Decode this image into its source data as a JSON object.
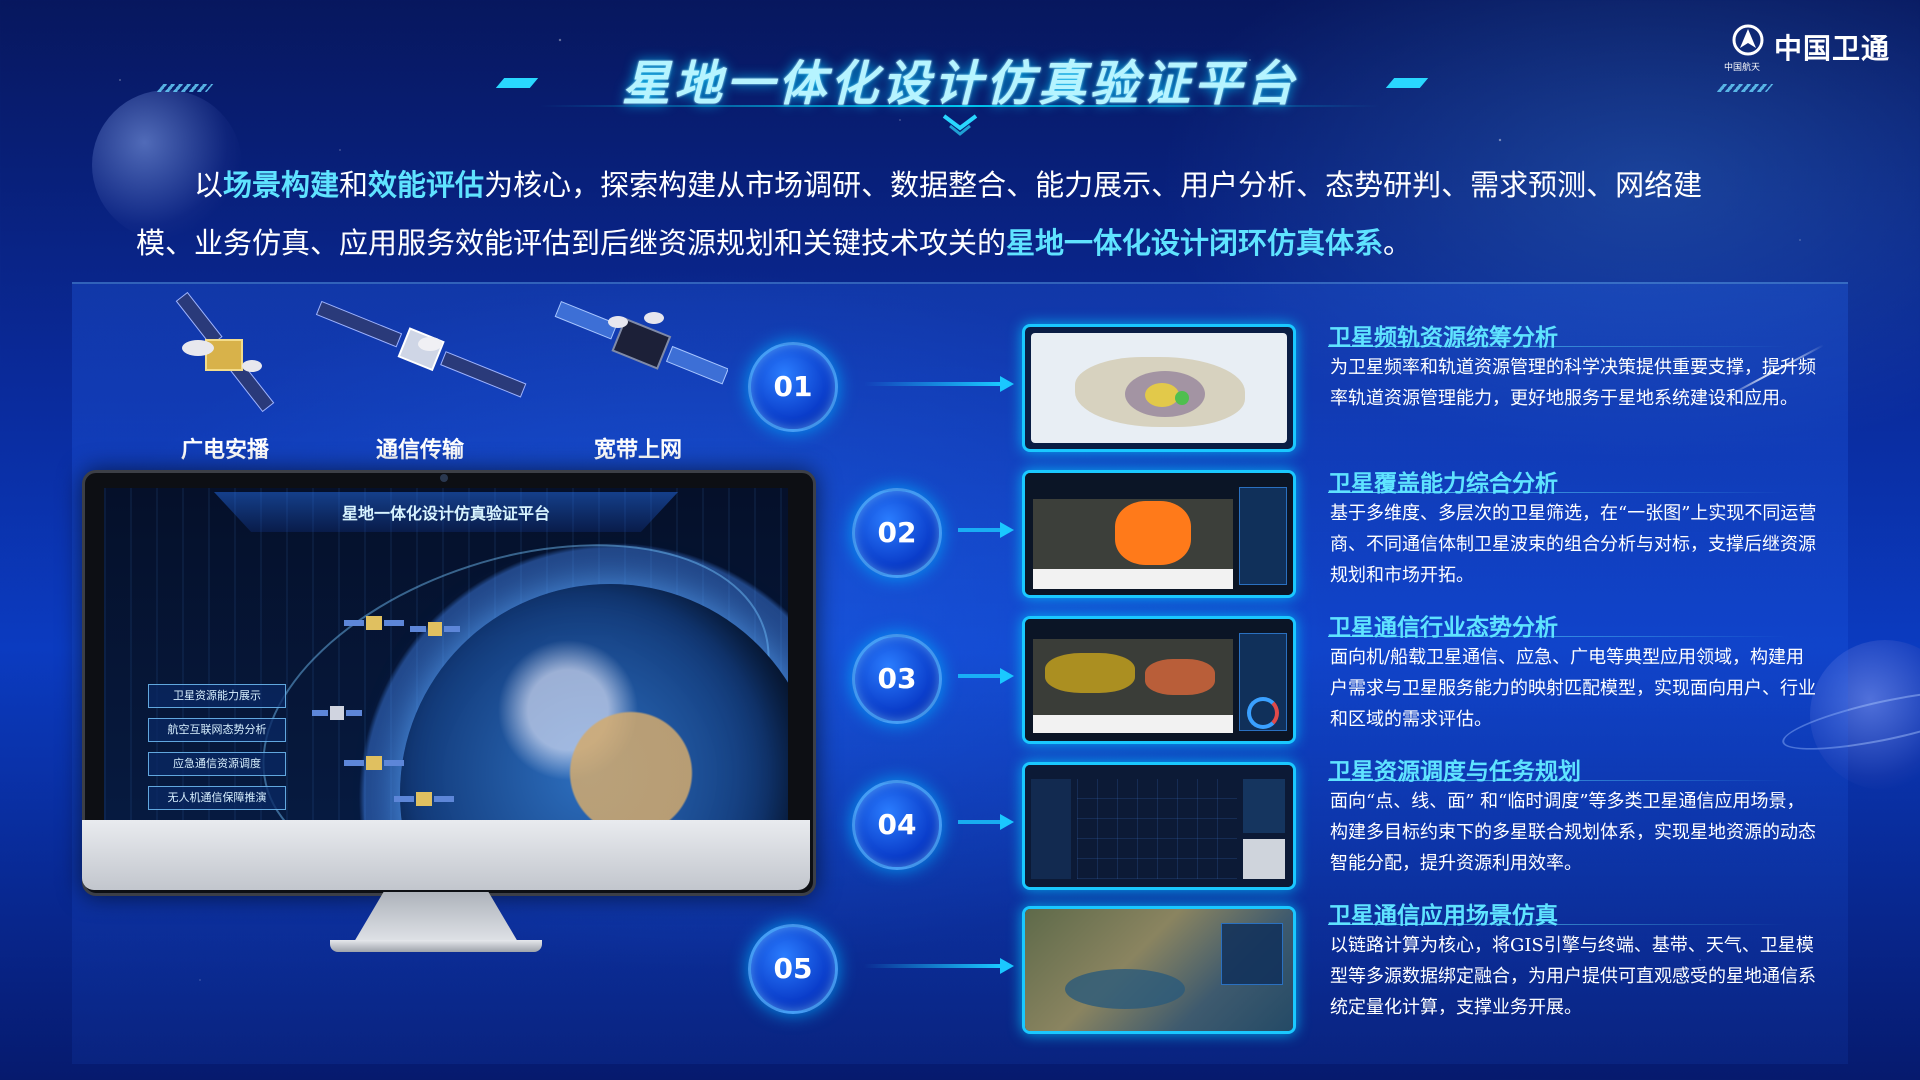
{
  "header": {
    "title": "星地一体化设计仿真验证平台",
    "logo_text": "中国卫通",
    "logo_sub": "中国航天"
  },
  "intro": {
    "p1": "以",
    "h1": "场景构建",
    "p2": "和",
    "h2": "效能评估",
    "p3": "为核心，探索构建从市场调研、数据整合、能力展示、用户分析、态势研判、需求预测、网络建模、业务仿真、应用服务效能评估到后继资源规划和关键技术攻关的",
    "h3": "星地一体化设计闭环仿真体系",
    "p4": "。"
  },
  "satellites": [
    {
      "label": "广电安播",
      "icon": "broadcast-satellite-icon"
    },
    {
      "label": "通信传输",
      "icon": "communication-satellite-icon"
    },
    {
      "label": "宽带上网",
      "icon": "broadband-satellite-icon"
    }
  ],
  "monitor": {
    "screen_title": "星地一体化设计仿真验证平台",
    "menu": [
      "卫星资源能力展示",
      "航空互联网态势分析",
      "应急通信资源调度",
      "无人机通信保障推演"
    ]
  },
  "steps": [
    {
      "number": "01",
      "title": "卫星频轨资源统筹分析",
      "desc": "为卫星频率和轨道资源管理的科学决策提供重要支撑，提升频率轨道资源管理能力，更好地服务于星地系统建设和应用。"
    },
    {
      "number": "02",
      "title": "卫星覆盖能力综合分析",
      "desc": "基于多维度、多层次的卫星筛选，在“一张图”上实现不同运营商、不同通信体制卫星波束的组合分析与对标，支撑后继资源规划和市场开拓。"
    },
    {
      "number": "03",
      "title": "卫星通信行业态势分析",
      "desc": "面向机/船载卫星通信、应急、广电等典型应用领域，构建用户需求与卫星服务能力的映射匹配模型，实现面向用户、行业和区域的需求评估。"
    },
    {
      "number": "04",
      "title": "卫星资源调度与任务规划",
      "desc": "面向“点、线、面” 和“临时调度”等多类卫星通信应用场景，构建多目标约束下的多星联合规划体系，实现星地资源的动态智能分配，提升资源利用效率。"
    },
    {
      "number": "05",
      "title": "卫星通信应用场景仿真",
      "desc": "以链路计算为核心，将GIS引擎与终端、基带、天气、卫星模型等多源数据绑定融合，为用户提供可直观感受的星地通信系统定量化计算，支撑业务开展。"
    }
  ],
  "colors": {
    "accent": "#5fe3ff",
    "thumb_border": "#1ac8ff",
    "badge": "#0b3ecb"
  }
}
